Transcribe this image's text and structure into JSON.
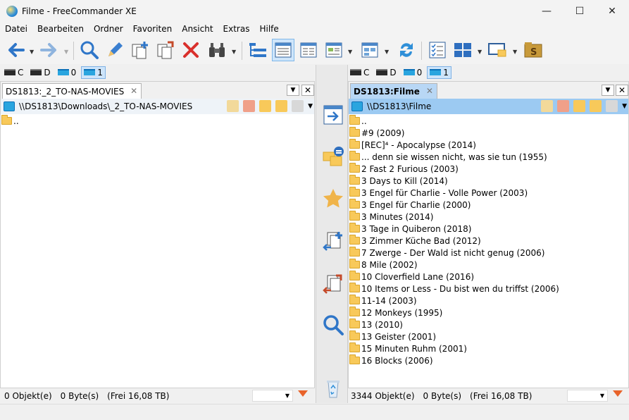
{
  "window": {
    "title": "Filme - FreeCommander XE"
  },
  "menu": [
    "Datei",
    "Bearbeiten",
    "Ordner",
    "Favoriten",
    "Ansicht",
    "Extras",
    "Hilfe"
  ],
  "drives": {
    "left": [
      "C",
      "D",
      "0",
      "1"
    ],
    "right": [
      "C",
      "D",
      "0",
      "1"
    ],
    "active": "1"
  },
  "left_panel": {
    "tab_label": "DS1813:_2_TO-NAS-MOVIES",
    "path": "\\\\DS1813\\Downloads\\_2_TO-NAS-MOVIES",
    "files": [
      ".."
    ],
    "status": {
      "objects": "0 Objekt(e)",
      "bytes": "0 Byte(s)",
      "free": "(Frei 16,08 TB)"
    }
  },
  "right_panel": {
    "tab_label": "DS1813:Filme",
    "path": "\\\\DS1813\\Filme",
    "files": [
      "..",
      "#9 (2009)",
      "[REC]⁴ - Apocalypse (2014)",
      "... denn sie wissen nicht, was sie tun (1955)",
      "2 Fast 2 Furious (2003)",
      "3 Days to Kill (2014)",
      "3 Engel für Charlie - Volle Power (2003)",
      "3 Engel für Charlie (2000)",
      "3 Minutes (2014)",
      "3 Tage in Quiberon (2018)",
      "3 Zimmer Küche Bad (2012)",
      "7 Zwerge - Der Wald ist nicht genug (2006)",
      "8 Mile (2002)",
      "10 Cloverfield Lane (2016)",
      "10 Items or Less - Du bist wen du triffst (2006)",
      "11-14 (2003)",
      "12 Monkeys (1995)",
      "13 (2010)",
      "13 Geister (2001)",
      "15 Minuten Ruhm (2001)",
      "16 Blocks (2006)"
    ],
    "status": {
      "objects": "3344 Objekt(e)",
      "bytes": "0 Byte(s)",
      "free": "(Frei 16,08 TB)"
    }
  },
  "colors": {
    "accent": "#1e7fd8",
    "active_path": "#9ccaf2",
    "folder": "#f8c95a",
    "filter": "#e8632a"
  }
}
